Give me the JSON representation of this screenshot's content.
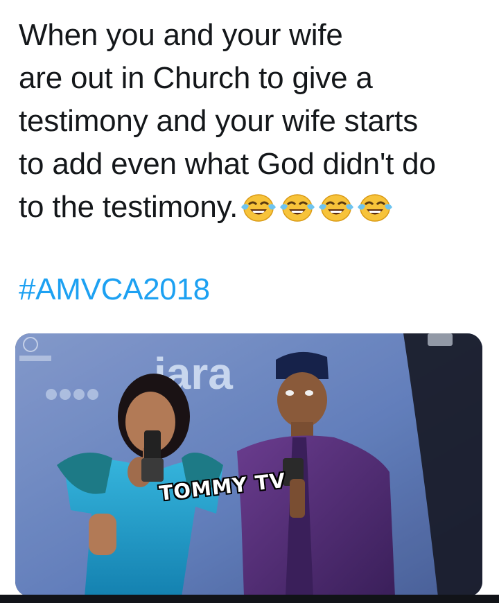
{
  "post": {
    "text_lines": [
      "When you and your wife",
      "are out in Church to give a",
      "testimony and your wife starts",
      "to add even what God didn't do",
      "to the testimony."
    ],
    "emoji_name": "face-with-tears-of-joy-icon",
    "emoji_count": 4,
    "hashtag": "#AMVCA2018"
  },
  "image": {
    "watermark": "TOMMY TV",
    "backdrop_logo": "iara",
    "colors": {
      "backdrop": "#5a78b8",
      "dress": "#1e9fc8",
      "agbada": "#4a2a6e",
      "cap": "#16224a"
    }
  }
}
